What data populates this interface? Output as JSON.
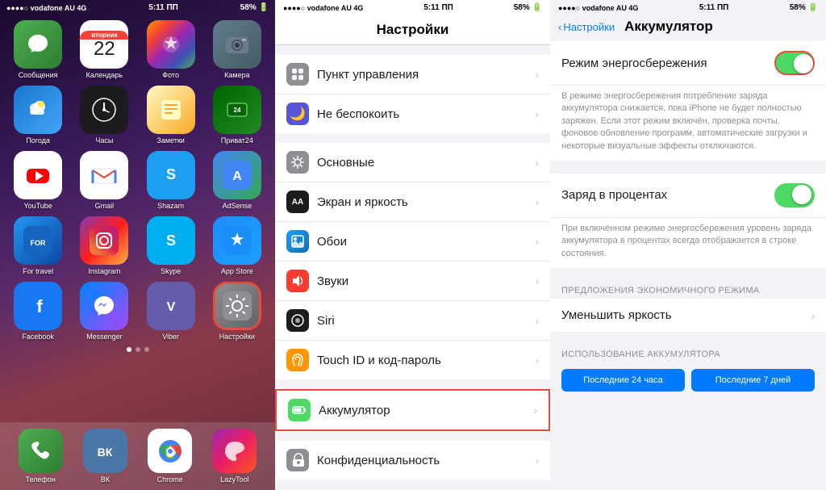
{
  "homeScreen": {
    "statusBar": {
      "carrier": "vodafone AU",
      "network": "4G",
      "time": "5:11 ПП",
      "battery": "58%"
    },
    "apps": [
      {
        "id": "messages",
        "label": "Сообщения",
        "emoji": "💬",
        "colorClass": "app-messages"
      },
      {
        "id": "calendar",
        "label": "Календарь",
        "colorClass": "app-calendar",
        "isCalendar": true,
        "day": "вторник",
        "date": "22"
      },
      {
        "id": "photos",
        "label": "Фото",
        "emoji": "🌸",
        "colorClass": "app-photos"
      },
      {
        "id": "camera",
        "label": "Камера",
        "emoji": "📷",
        "colorClass": "app-camera"
      },
      {
        "id": "weather",
        "label": "Погода",
        "emoji": "⛅",
        "colorClass": "app-weather"
      },
      {
        "id": "clock",
        "label": "Часы",
        "emoji": "🕐",
        "colorClass": "app-clock"
      },
      {
        "id": "notes",
        "label": "Заметки",
        "emoji": "📝",
        "colorClass": "app-notes"
      },
      {
        "id": "privat24",
        "label": "Приват24",
        "emoji": "💳",
        "colorClass": "app-privat24"
      },
      {
        "id": "youtube",
        "label": "YouTube",
        "emoji": "▶",
        "colorClass": "app-youtube"
      },
      {
        "id": "gmail",
        "label": "Gmail",
        "emoji": "✉",
        "colorClass": "app-gmail"
      },
      {
        "id": "shazam",
        "label": "Shazam",
        "emoji": "S",
        "colorClass": "app-shazam"
      },
      {
        "id": "adsense",
        "label": "AdSense",
        "emoji": "A",
        "colorClass": "app-adsense"
      },
      {
        "id": "fortravel",
        "label": "For travel",
        "emoji": "🗺",
        "colorClass": "app-fortravel"
      },
      {
        "id": "instagram",
        "label": "Instagram",
        "emoji": "📷",
        "colorClass": "app-instagram"
      },
      {
        "id": "skype",
        "label": "Skype",
        "emoji": "S",
        "colorClass": "app-skype"
      },
      {
        "id": "appstore",
        "label": "App Store",
        "emoji": "A",
        "colorClass": "app-appstore"
      },
      {
        "id": "facebook",
        "label": "Facebook",
        "emoji": "f",
        "colorClass": "app-facebook"
      },
      {
        "id": "messenger",
        "label": "Messenger",
        "emoji": "💬",
        "colorClass": "app-messenger"
      },
      {
        "id": "viber",
        "label": "Viber",
        "emoji": "V",
        "colorClass": "app-viber"
      },
      {
        "id": "settings",
        "label": "Настройки",
        "emoji": "⚙",
        "colorClass": "app-settings",
        "highlighted": true
      }
    ],
    "dock": [
      {
        "id": "phone",
        "label": "Телефон",
        "emoji": "📞",
        "colorClass": "app-messages"
      },
      {
        "id": "vk",
        "label": "ВК",
        "emoji": "V",
        "colorClass": "app-facebook"
      },
      {
        "id": "chrome",
        "label": "Chrome",
        "emoji": "◉",
        "colorClass": "app-weather"
      },
      {
        "id": "lazytool",
        "label": "LazyTool",
        "emoji": "🌀",
        "colorClass": "app-instagram"
      }
    ]
  },
  "settingsPanel": {
    "statusBar": {
      "carrier": "vodafone AU",
      "network": "4G",
      "time": "5:11 ПП",
      "battery": "58%"
    },
    "title": "Настройки",
    "rows": [
      {
        "id": "control-center",
        "label": "Пункт управления",
        "iconBg": "#8e8e93",
        "emoji": "⊞"
      },
      {
        "id": "do-not-disturb",
        "label": "Не беспокоить",
        "iconBg": "#5856d6",
        "emoji": "🌙"
      },
      {
        "id": "general",
        "label": "Основные",
        "iconBg": "#8e8e93",
        "emoji": "⚙"
      },
      {
        "id": "display",
        "label": "Экран и яркость",
        "iconBg": "#1c1c1e",
        "emoji": "AA"
      },
      {
        "id": "wallpaper",
        "label": "Обои",
        "iconBg": "#1d9ff7",
        "emoji": "🖼"
      },
      {
        "id": "sounds",
        "label": "Звуки",
        "iconBg": "#ff3b30",
        "emoji": "🔔"
      },
      {
        "id": "siri",
        "label": "Siri",
        "iconBg": "#1c1c1e",
        "emoji": "◉"
      },
      {
        "id": "touchid",
        "label": "Touch ID и код-пароль",
        "iconBg": "#ff9500",
        "emoji": "👆"
      },
      {
        "id": "battery",
        "label": "Аккумулятор",
        "iconBg": "#4cd964",
        "emoji": "🔋",
        "highlighted": true
      },
      {
        "id": "privacy",
        "label": "Конфиденциальность",
        "iconBg": "#8e8e93",
        "emoji": "✋"
      }
    ]
  },
  "batteryPanel": {
    "statusBar": {
      "carrier": "vodafone AU",
      "network": "4G",
      "time": "5:11 ПП",
      "battery": "58%"
    },
    "backLabel": "Настройки",
    "title": "Аккумулятор",
    "powerSavingMode": {
      "label": "Режим энергосбережения",
      "isOn": true,
      "description": "В режиме энергосбережения потребление заряда аккумулятора снижается, пока iPhone не будет полностью заряжен. Если этот режим включён, проверка почты, фоновое обновление программ, автоматические загрузки и некоторые визуальные эффекты отключаются."
    },
    "batteryPercentage": {
      "label": "Заряд в процентах",
      "isOn": true,
      "description": "При включённом режиме энергосбережения уровень заряда аккумулятора в процентах всегда отображается в строке состояния."
    },
    "economyHeader": "ПРЕДЛОЖЕНИЯ ЭКОНОМИЧНОГО РЕЖИМА",
    "reduceBrightness": {
      "label": "Уменьшить яркость"
    },
    "usageHeader": "ИСПОЛЬЗОВАНИЕ АККУМУЛЯТОРА",
    "tabs": [
      {
        "label": "Последние 24 часа"
      },
      {
        "label": "Последние 7 дней"
      }
    ]
  }
}
